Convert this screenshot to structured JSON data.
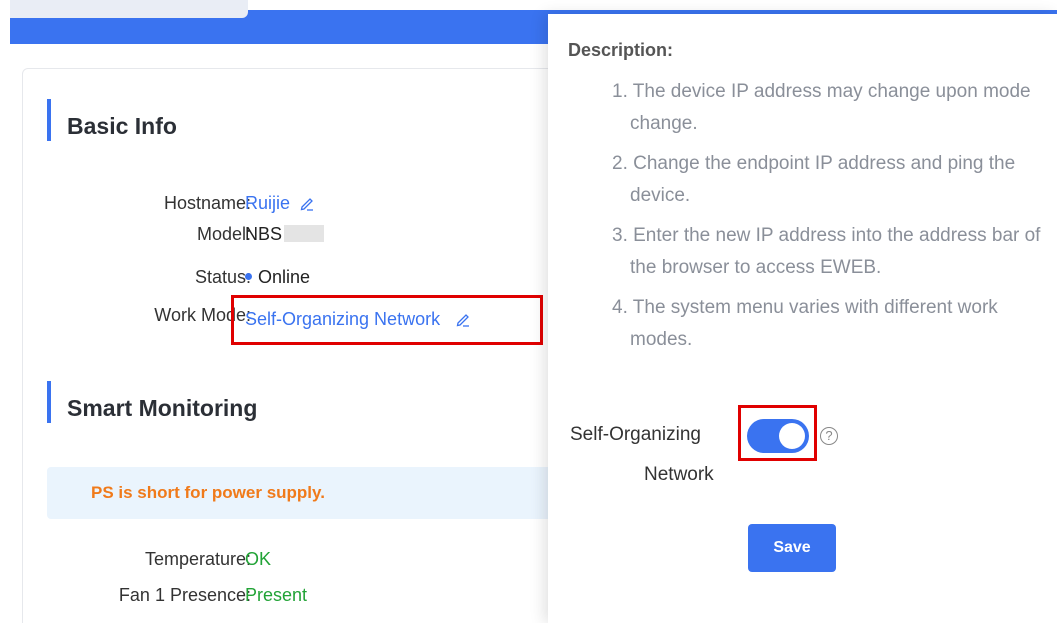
{
  "header": {
    "accent_color": "#3a73f0"
  },
  "basic_info": {
    "title": "Basic Info",
    "hostname_label": "Hostname:",
    "hostname_value": "Ruijie",
    "model_label": "Model:",
    "model_value": "NBS",
    "status_label": "Status:",
    "status_value": "Online",
    "work_mode_label": "Work Mode:",
    "work_mode_value": "Self-Organizing Network"
  },
  "smart_monitoring": {
    "title": "Smart Monitoring",
    "notice": "PS is short for power supply.",
    "temperature_label": "Temperature:",
    "temperature_value": "OK",
    "fan_label": "Fan 1 Presence:",
    "fan_value": "Present"
  },
  "drawer": {
    "description_title": "Description:",
    "items": [
      "1. The device IP address may change upon mode change.",
      "2. Change the endpoint IP address and ping the device.",
      "3. Enter the new IP address into the address bar of the browser to access EWEB.",
      "4. The system menu varies with different work modes."
    ],
    "toggle_label_line1": "Self-Organizing",
    "toggle_label_line2": "Network",
    "toggle_state": "on",
    "help_icon": "?",
    "save_label": "Save"
  },
  "colors": {
    "accent": "#3a73f0",
    "success": "#21a336",
    "warning": "#f07a1a",
    "highlight": "#e00000"
  }
}
